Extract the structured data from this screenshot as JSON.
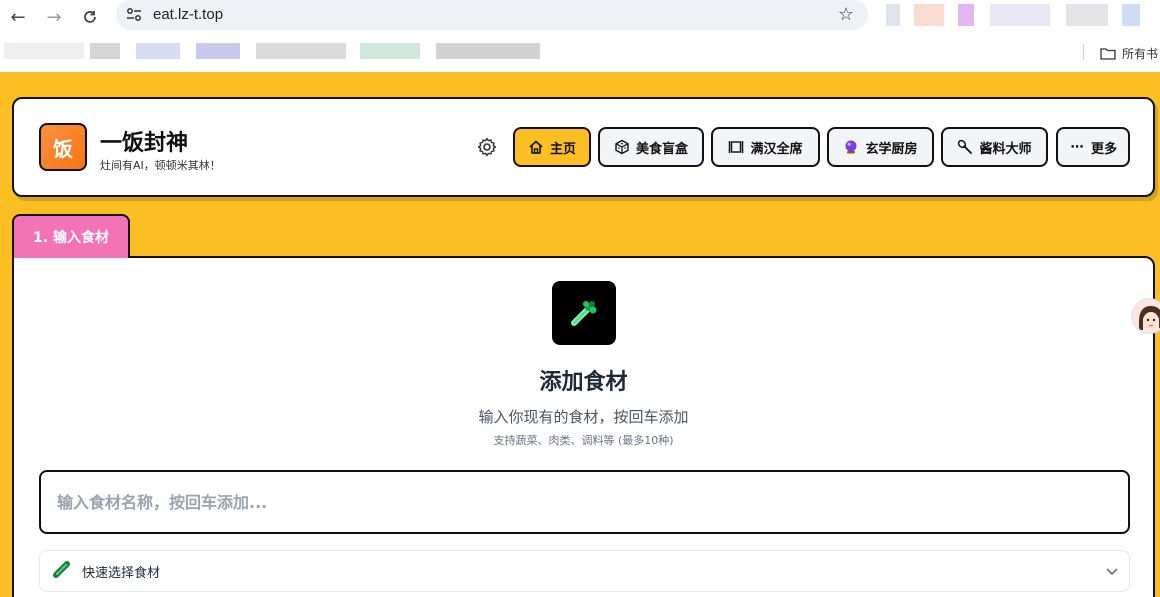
{
  "browser": {
    "url": "eat.lz-t.top",
    "bookmarks_folder_label": "所有书"
  },
  "header": {
    "logo_char": "饭",
    "title": "一饭封神",
    "subtitle": "灶间有AI，顿顿米其林！",
    "nav": [
      {
        "label": "主页",
        "icon": "home-icon",
        "active": true
      },
      {
        "label": "美食盲盒",
        "icon": "dice-icon",
        "active": false
      },
      {
        "label": "满汉全席",
        "icon": "feast-icon",
        "active": false
      },
      {
        "label": "玄学厨房",
        "icon": "crystal-ball-icon",
        "active": false
      },
      {
        "label": "酱料大师",
        "icon": "spoon-icon",
        "active": false
      },
      {
        "label": "更多",
        "icon": "ellipsis-icon",
        "active": false
      }
    ]
  },
  "step_tab": {
    "label": "1. 输入食材"
  },
  "ingredients": {
    "icon": "celery-icon",
    "title": "添加食材",
    "description": "输入你现有的食材，按回车添加",
    "hint": "支持蔬菜、肉类、调料等 (最多10种)",
    "input_placeholder": "输入食材名称，按回车添加...",
    "quick_select_label": "快速选择食材"
  },
  "colors": {
    "page_bg": "#fbbf24",
    "active_nav": "#fbbf24",
    "tab_pink": "#f472b6",
    "logo_orange": "#f97316"
  }
}
